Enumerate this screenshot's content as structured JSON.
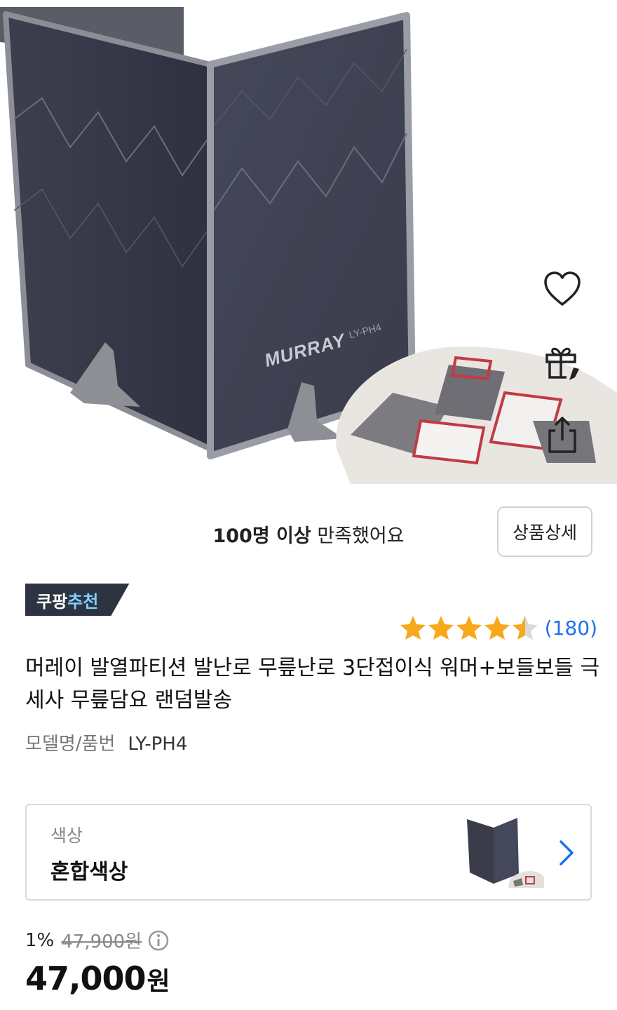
{
  "hero": {
    "brand_text": "MURRAY",
    "model_text": "LY-PH4"
  },
  "satisfaction": {
    "bold": "100명 이상",
    "rest": " 만족했어요",
    "detail_button": "상품상세"
  },
  "badge": {
    "part1": "쿠팡",
    "part2": "추천"
  },
  "rating": {
    "value": 4.5,
    "max": 5,
    "count_label": "(180)"
  },
  "product": {
    "title": "머레이 발열파티션 발난로 무릎난로 3단접이식 워머+보들보들 극세사 무릎담요 랜덤발송",
    "model_label": "모델명/품번",
    "model_value": "LY-PH4"
  },
  "option": {
    "label": "색상",
    "value": "혼합색상"
  },
  "price": {
    "discount": "1%",
    "original": "47,900원",
    "current": "47,000",
    "currency": "원"
  },
  "colors": {
    "accent_blue": "#1a73e8",
    "star": "#f7a91b",
    "badge_bg": "#2d3340",
    "badge_accent": "#7fd0ff"
  },
  "icons": [
    "heart-icon",
    "gift-icon",
    "share-icon",
    "star-icon",
    "chevron-right-icon",
    "info-icon"
  ]
}
